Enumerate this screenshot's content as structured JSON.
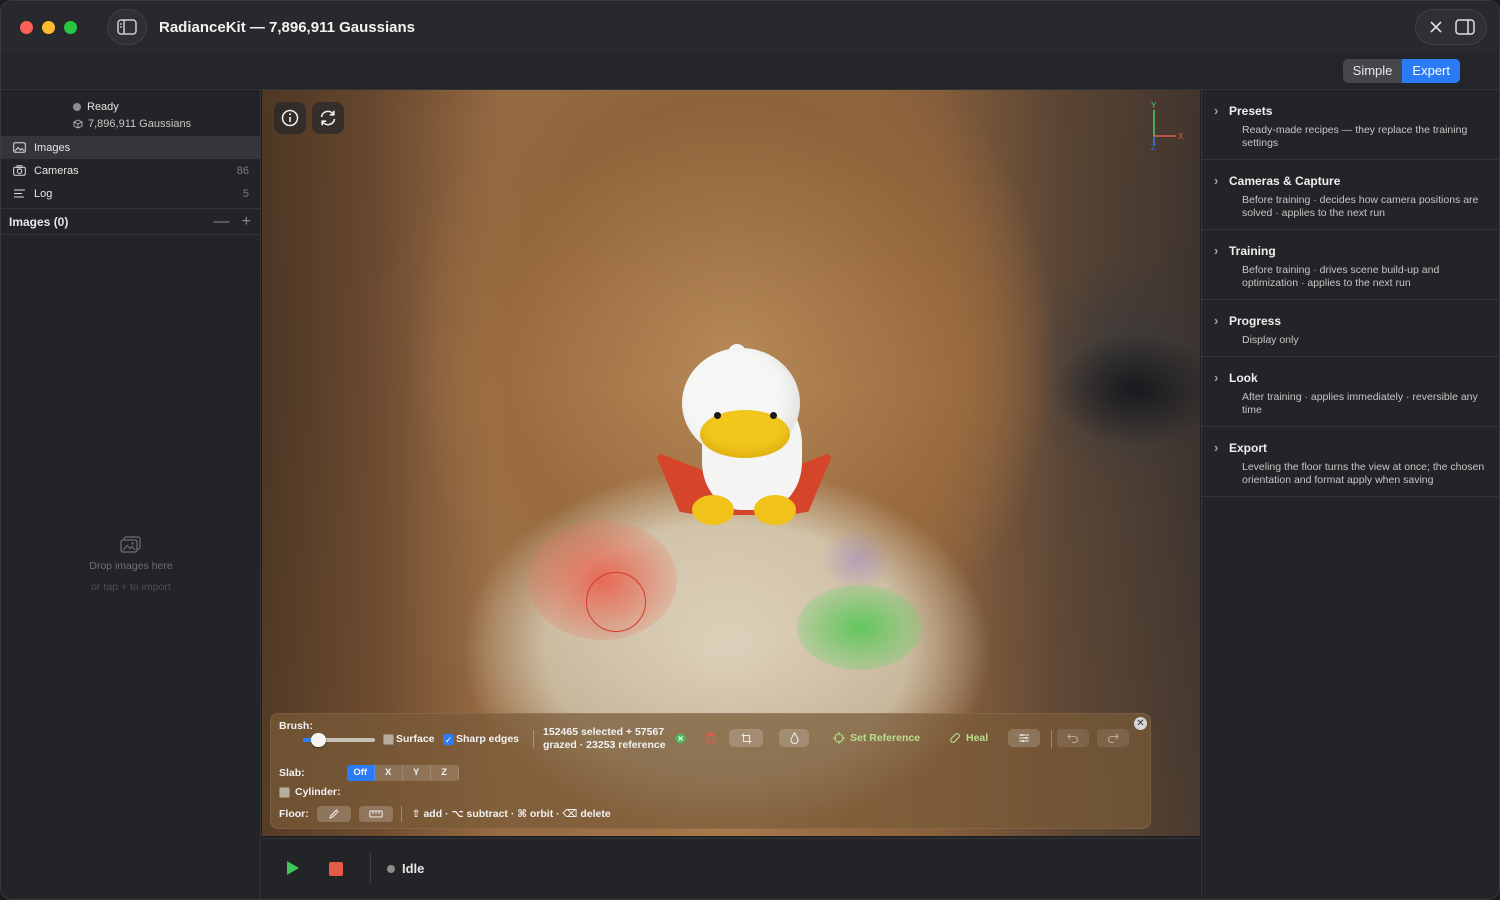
{
  "window": {
    "title": "RadianceKit — 7,896,911 Gaussians"
  },
  "mode": {
    "options": [
      "Simple",
      "Expert"
    ],
    "selected": "Expert"
  },
  "sidebar": {
    "status": "Ready",
    "gaussians": "7,896,911 Gaussians",
    "items": [
      {
        "label": "Images",
        "count": ""
      },
      {
        "label": "Cameras",
        "count": "86"
      },
      {
        "label": "Log",
        "count": "5"
      }
    ],
    "images_header": "Images (0)",
    "dropzone": {
      "line1": "Drop images here",
      "line2": "or tap + to import"
    }
  },
  "brush_panel": {
    "brush_label": "Brush:",
    "surface_label": "Surface",
    "surface_checked": false,
    "sharp_edges_label": "Sharp edges",
    "sharp_edges_checked": true,
    "selection_info": "152465 selected + 57567 grazed · 23253 reference",
    "set_reference_label": "Set Reference",
    "heal_label": "Heal",
    "slab_label": "Slab:",
    "slab_options": [
      "Off",
      "X",
      "Y",
      "Z"
    ],
    "slab_selected": "Off",
    "cylinder_label": "Cylinder:",
    "floor_label": "Floor:",
    "hint": "⇧ add · ⌥ subtract · ⌘ orbit · ⌫ delete",
    "colors": {
      "green_tint": "#b8e08a",
      "accent": "#2c7bf6",
      "delete": "#e55a46"
    }
  },
  "axis": {
    "y": "Y",
    "x": "X",
    "z": "Z"
  },
  "bottombar": {
    "status": "Idle"
  },
  "inspector": {
    "sections": [
      {
        "title": "Presets",
        "desc": "Ready-made recipes — they replace the training settings"
      },
      {
        "title": "Cameras & Capture",
        "desc": "Before training · decides how camera positions are solved · applies to the next run"
      },
      {
        "title": "Training",
        "desc": "Before training · drives scene build-up and optimization · applies to the next run"
      },
      {
        "title": "Progress",
        "desc": "Display only"
      },
      {
        "title": "Look",
        "desc": "After training · applies immediately · reversible any time"
      },
      {
        "title": "Export",
        "desc": "Leveling the floor turns the view at once; the chosen orientation and format apply when saving"
      }
    ]
  }
}
